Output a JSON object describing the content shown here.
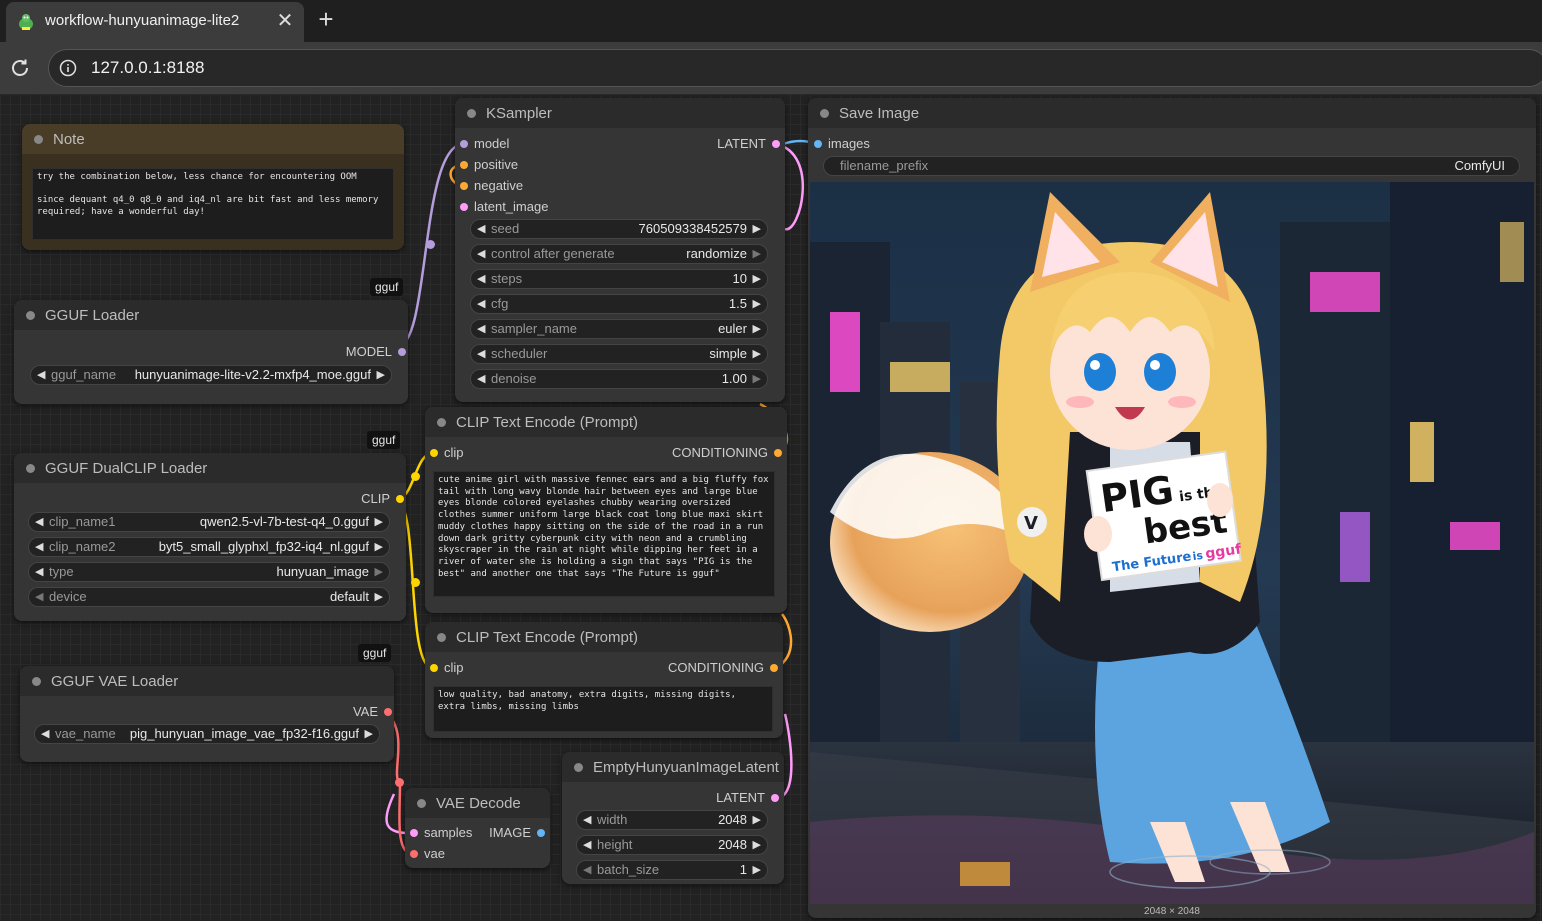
{
  "browser": {
    "tab_title": "workflow-hunyuanimage-lite2",
    "url": "127.0.0.1:8188"
  },
  "colors": {
    "model": "#b39ddb",
    "clip": "#ffd500",
    "vae": "#ff6e6e",
    "latent": "#ff9cf9",
    "conditioning": "#ffa931",
    "image": "#64b5f6",
    "note_bg": "#3a3020",
    "note_title": "#4a3d27"
  },
  "nodes": {
    "note": {
      "title": "Note",
      "text": "try the combination below, less chance for encountering OOM\n\nsince dequant q4_0 q8_0 and iq4_nl are bit fast and less memory required; have a wonderful day!"
    },
    "gguf_loader": {
      "badge": "gguf",
      "title": "GGUF Loader",
      "output": "MODEL",
      "widgets": [
        {
          "label": "gguf_name",
          "value": "hunyuanimage-lite-v2.2-mxfp4_moe.gguf"
        }
      ]
    },
    "dualclip_loader": {
      "badge": "gguf",
      "title": "GGUF DualCLIP Loader",
      "output": "CLIP",
      "widgets": [
        {
          "label": "clip_name1",
          "value": "qwen2.5-vl-7b-test-q4_0.gguf"
        },
        {
          "label": "clip_name2",
          "value": "byt5_small_glyphxl_fp32-iq4_nl.gguf"
        },
        {
          "label": "type",
          "value": "hunyuan_image"
        },
        {
          "label": "device",
          "value": "default"
        }
      ]
    },
    "vae_loader": {
      "badge": "gguf",
      "title": "GGUF VAE Loader",
      "output": "VAE",
      "widgets": [
        {
          "label": "vae_name",
          "value": "pig_hunyuan_image_vae_fp32-f16.gguf"
        }
      ]
    },
    "ksampler": {
      "title": "KSampler",
      "inputs": [
        "model",
        "positive",
        "negative",
        "latent_image"
      ],
      "output": "LATENT",
      "widgets": [
        {
          "label": "seed",
          "value": "760509338452579"
        },
        {
          "label": "control after generate",
          "value": "randomize"
        },
        {
          "label": "steps",
          "value": "10"
        },
        {
          "label": "cfg",
          "value": "1.5"
        },
        {
          "label": "sampler_name",
          "value": "euler"
        },
        {
          "label": "scheduler",
          "value": "simple"
        },
        {
          "label": "denoise",
          "value": "1.00"
        }
      ]
    },
    "clip_pos": {
      "title": "CLIP Text Encode (Prompt)",
      "input": "clip",
      "output": "CONDITIONING",
      "text": "cute anime girl with massive fennec ears and a big fluffy fox tail with long wavy blonde hair between eyes and large blue eyes blonde colored eyelashes chubby wearing oversized clothes summer uniform large black coat long blue maxi skirt muddy clothes happy sitting on the side of the road in a run down dark gritty cyberpunk city with neon and a crumbling skyscraper in the rain at night while dipping her feet in a river of water she is holding a sign that says \"PIG is the best\" and another one that says \"The Future is gguf\""
    },
    "clip_neg": {
      "title": "CLIP Text Encode (Prompt)",
      "input": "clip",
      "output": "CONDITIONING",
      "text": "low quality, bad anatomy, extra digits, missing digits, extra limbs, missing limbs"
    },
    "vae_decode": {
      "title": "VAE Decode",
      "inputs": [
        "samples",
        "vae"
      ],
      "output": "IMAGE"
    },
    "empty_latent": {
      "title": "EmptyHunyuanImageLatent",
      "output": "LATENT",
      "widgets": [
        {
          "label": "width",
          "value": "2048"
        },
        {
          "label": "height",
          "value": "2048"
        },
        {
          "label": "batch_size",
          "value": "1"
        }
      ]
    },
    "save_image": {
      "title": "Save Image",
      "input": "images",
      "widget": {
        "label": "filename_prefix",
        "value": "ComfyUI"
      },
      "image": {
        "sign_line1_big": "PIG",
        "sign_line1_small": "is the",
        "sign_line2": "best",
        "sign_line3a": "The Future",
        "sign_line3b": "is",
        "sign_line3c": "gguf"
      },
      "image_size": "2048 × 2048"
    }
  }
}
